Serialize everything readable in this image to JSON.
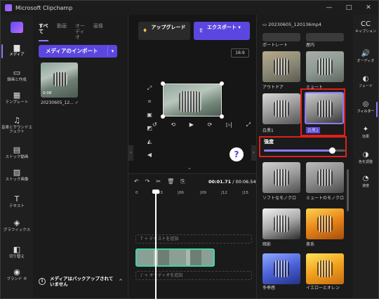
{
  "window": {
    "title": "Microsoft Clipchamp",
    "controls": [
      "—",
      "□",
      "✕"
    ]
  },
  "left_nav": [
    {
      "label": "メディア",
      "icon": "folder-icon",
      "glyph": "▆"
    },
    {
      "label": "録画と作成",
      "icon": "video-camera-icon",
      "glyph": "▭"
    },
    {
      "label": "テンプレート",
      "icon": "template-icon",
      "glyph": "▦"
    },
    {
      "label": "音楽とサウンドエフェクト",
      "icon": "music-icon",
      "glyph": "♫"
    },
    {
      "label": "ストック動画",
      "icon": "film-icon",
      "glyph": "▤"
    },
    {
      "label": "ストック画像",
      "icon": "image-icon",
      "glyph": "▨"
    },
    {
      "label": "テキスト",
      "icon": "text-icon",
      "glyph": "T"
    },
    {
      "label": "グラフィックス",
      "icon": "shapes-icon",
      "glyph": "◈"
    },
    {
      "label": "切り替え",
      "icon": "transition-icon",
      "glyph": "◧"
    },
    {
      "label": "ブランド キ",
      "icon": "brand-kit-icon",
      "glyph": "◉"
    }
  ],
  "media": {
    "tabs": [
      "すべて",
      "動画",
      "オーディオ",
      "画像"
    ],
    "import_label": "メディアのインポート",
    "thumb": {
      "duration": "0:08",
      "name": "20230605_12...",
      "check": "✓"
    },
    "backup_text": "メディアはバックアップされていません"
  },
  "editor": {
    "upgrade_label": "アップグレード",
    "export_label": "エクスポート",
    "aspect_ratio": "16:9",
    "help": "?",
    "tools": [
      "⤢",
      "⌗",
      "▣",
      "◩",
      "◭",
      "◀"
    ],
    "playback": [
      "↺",
      "⟲",
      "▶",
      "⟳",
      "▷|",
      "⤢"
    ]
  },
  "timeline": {
    "tools": [
      "↶",
      "↷",
      "✂",
      "🗑",
      "⎘"
    ],
    "current_time": "00:01.71",
    "total_time": "/ 00:06.54",
    "ruler": [
      "0",
      "|03",
      "|06",
      "|09",
      "|12",
      "|15"
    ],
    "add_text": "T + テキストを追加",
    "add_audio": "♪ + オーディオを追加"
  },
  "filters": {
    "file_name": "20230605_120136mp4",
    "items": [
      {
        "label": "ポートレート"
      },
      {
        "label": "屋内"
      },
      {
        "label": "アウトドア"
      },
      {
        "label": "ミュート"
      },
      {
        "label": "白黒1"
      },
      {
        "label": "白黒2"
      },
      {
        "label": "ソフトなモノクロ"
      },
      {
        "label": "ミュートのモノクロ"
      },
      {
        "label": "暗影"
      },
      {
        "label": "茶系"
      },
      {
        "label": "冬季感"
      },
      {
        "label": "イエローとオレン"
      }
    ],
    "intensity_label": "強度",
    "intensity_value": 0.84
  },
  "right_nav": [
    {
      "label": "キャプション",
      "icon": "cc-icon",
      "glyph": "CC"
    },
    {
      "label": "オーディオ",
      "icon": "speaker-icon",
      "glyph": "🔊"
    },
    {
      "label": "フェード",
      "icon": "fade-icon",
      "glyph": "◐"
    },
    {
      "label": "フィルター",
      "icon": "filter-icon",
      "glyph": "◎"
    },
    {
      "label": "効果",
      "icon": "effects-icon",
      "glyph": "✦"
    },
    {
      "label": "色を調整",
      "icon": "color-adjust-icon",
      "glyph": "◑"
    },
    {
      "label": "速度",
      "icon": "speed-icon",
      "glyph": "◔"
    }
  ],
  "colors": {
    "accent": "#5b47e0",
    "selection_red": "#e0201b",
    "clip_border": "#43d3a6"
  }
}
